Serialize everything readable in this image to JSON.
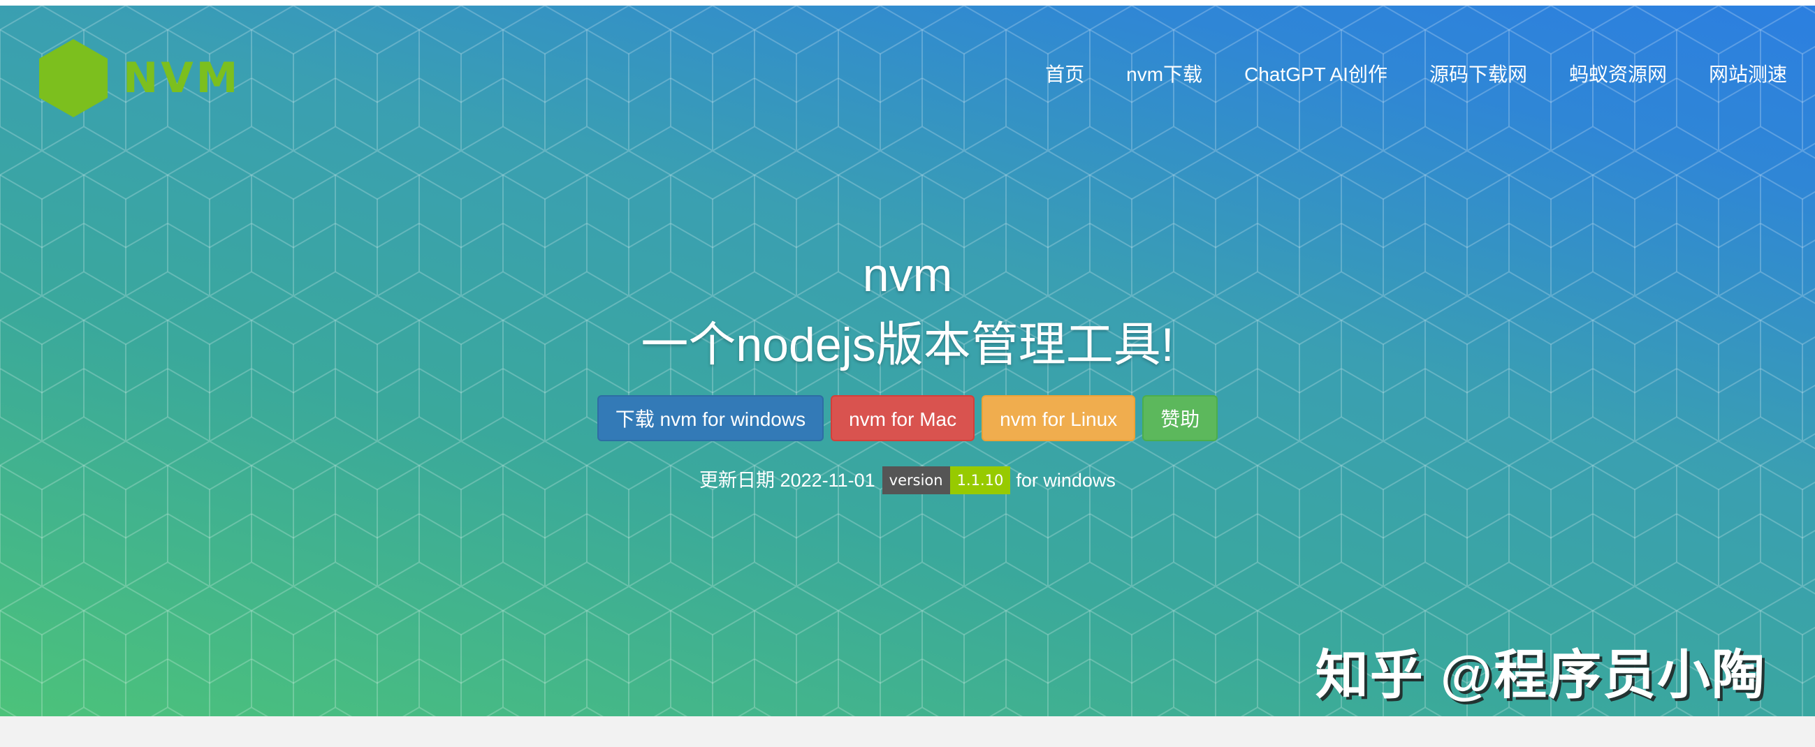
{
  "logo": {
    "text": "NVM",
    "hex_color": "#7cbf1e",
    "icon": "hexagon-logo-icon"
  },
  "nav": {
    "items": [
      {
        "label": "首页"
      },
      {
        "label": "nvm下载"
      },
      {
        "label": "ChatGPT AI创作"
      },
      {
        "label": "源码下载网"
      },
      {
        "label": "蚂蚁资源网"
      },
      {
        "label": "网站测速"
      }
    ]
  },
  "hero": {
    "title": "nvm",
    "subtitle": "一个nodejs版本管理工具!",
    "gradient_colors": [
      "#4cc27a",
      "#3a9fb2",
      "#2c7fe0"
    ]
  },
  "buttons": {
    "windows_label": "下载 nvm for windows",
    "mac_label": "nvm for Mac",
    "linux_label": "nvm for Linux",
    "donate_label": "赞助",
    "colors": {
      "windows": "#337ab7",
      "mac": "#d9534f",
      "linux": "#f0ad4e",
      "donate": "#5cb85c"
    }
  },
  "update": {
    "date_text": "更新日期 2022-11-01",
    "badge_label": "version",
    "badge_value": "1.1.10",
    "suffix": "for windows"
  },
  "watermark": {
    "text": "知乎 @程序员小陶"
  }
}
